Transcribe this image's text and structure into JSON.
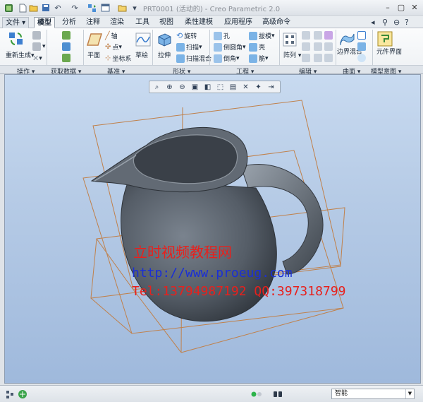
{
  "window": {
    "title": "PRT0001 (活动的) - Creo Parametric 2.0"
  },
  "menu_tabs": [
    "文件",
    "模型",
    "分析",
    "注释",
    "渲染",
    "工具",
    "视图",
    "柔性建模",
    "应用程序",
    "高级命令"
  ],
  "active_tab": "模型",
  "ribbon": {
    "operations": {
      "regenerate": "重新生成",
      "group": "操作"
    },
    "get_data": {
      "group": "获取数据"
    },
    "datum": {
      "plane": "平面",
      "axis": "轴",
      "point": "点",
      "csys": "坐标系",
      "sketch": "草绘",
      "group": "基准"
    },
    "shapes": {
      "extrude": "拉伸",
      "revolve": "旋转",
      "sweep": "扫描",
      "swept_blend": "扫描混合",
      "group": "形状"
    },
    "engineering": {
      "hole": "孔",
      "round": "倒圆角",
      "chamfer": "倒角",
      "draft": "拔模",
      "shell": "壳",
      "rib": "筋",
      "group": "工程"
    },
    "editing": {
      "pattern": "阵列",
      "group": "编辑"
    },
    "surfaces": {
      "boundary_blend": "边界混合",
      "group": "曲面"
    },
    "model_intent": {
      "component_interface": "元件界面",
      "group": "模型意图"
    }
  },
  "watermark": {
    "line1": "立时视频教程网",
    "line2": "http://www.proeug.com",
    "line3": "Tel:13794987192  QQ:397318799"
  },
  "status": {
    "filter_value": "智能"
  },
  "colors": {
    "watermark_red": "#e8201c",
    "watermark_blue": "#1a2fd6",
    "datum_plane": "#c0804a",
    "model": "#5e6670"
  }
}
